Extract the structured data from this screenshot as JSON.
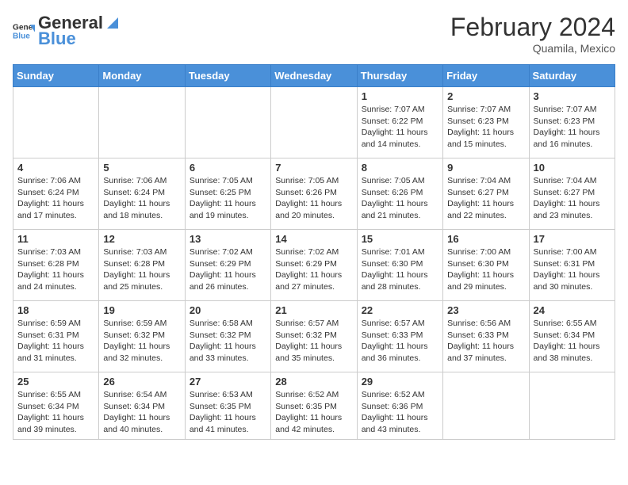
{
  "header": {
    "logo_general": "General",
    "logo_blue": "Blue",
    "month_title": "February 2024",
    "subtitle": "Quamila, Mexico"
  },
  "days_of_week": [
    "Sunday",
    "Monday",
    "Tuesday",
    "Wednesday",
    "Thursday",
    "Friday",
    "Saturday"
  ],
  "weeks": [
    [
      {
        "day": "",
        "info": ""
      },
      {
        "day": "",
        "info": ""
      },
      {
        "day": "",
        "info": ""
      },
      {
        "day": "",
        "info": ""
      },
      {
        "day": "1",
        "info": "Sunrise: 7:07 AM\nSunset: 6:22 PM\nDaylight: 11 hours and 14 minutes."
      },
      {
        "day": "2",
        "info": "Sunrise: 7:07 AM\nSunset: 6:23 PM\nDaylight: 11 hours and 15 minutes."
      },
      {
        "day": "3",
        "info": "Sunrise: 7:07 AM\nSunset: 6:23 PM\nDaylight: 11 hours and 16 minutes."
      }
    ],
    [
      {
        "day": "4",
        "info": "Sunrise: 7:06 AM\nSunset: 6:24 PM\nDaylight: 11 hours and 17 minutes."
      },
      {
        "day": "5",
        "info": "Sunrise: 7:06 AM\nSunset: 6:24 PM\nDaylight: 11 hours and 18 minutes."
      },
      {
        "day": "6",
        "info": "Sunrise: 7:05 AM\nSunset: 6:25 PM\nDaylight: 11 hours and 19 minutes."
      },
      {
        "day": "7",
        "info": "Sunrise: 7:05 AM\nSunset: 6:26 PM\nDaylight: 11 hours and 20 minutes."
      },
      {
        "day": "8",
        "info": "Sunrise: 7:05 AM\nSunset: 6:26 PM\nDaylight: 11 hours and 21 minutes."
      },
      {
        "day": "9",
        "info": "Sunrise: 7:04 AM\nSunset: 6:27 PM\nDaylight: 11 hours and 22 minutes."
      },
      {
        "day": "10",
        "info": "Sunrise: 7:04 AM\nSunset: 6:27 PM\nDaylight: 11 hours and 23 minutes."
      }
    ],
    [
      {
        "day": "11",
        "info": "Sunrise: 7:03 AM\nSunset: 6:28 PM\nDaylight: 11 hours and 24 minutes."
      },
      {
        "day": "12",
        "info": "Sunrise: 7:03 AM\nSunset: 6:28 PM\nDaylight: 11 hours and 25 minutes."
      },
      {
        "day": "13",
        "info": "Sunrise: 7:02 AM\nSunset: 6:29 PM\nDaylight: 11 hours and 26 minutes."
      },
      {
        "day": "14",
        "info": "Sunrise: 7:02 AM\nSunset: 6:29 PM\nDaylight: 11 hours and 27 minutes."
      },
      {
        "day": "15",
        "info": "Sunrise: 7:01 AM\nSunset: 6:30 PM\nDaylight: 11 hours and 28 minutes."
      },
      {
        "day": "16",
        "info": "Sunrise: 7:00 AM\nSunset: 6:30 PM\nDaylight: 11 hours and 29 minutes."
      },
      {
        "day": "17",
        "info": "Sunrise: 7:00 AM\nSunset: 6:31 PM\nDaylight: 11 hours and 30 minutes."
      }
    ],
    [
      {
        "day": "18",
        "info": "Sunrise: 6:59 AM\nSunset: 6:31 PM\nDaylight: 11 hours and 31 minutes."
      },
      {
        "day": "19",
        "info": "Sunrise: 6:59 AM\nSunset: 6:32 PM\nDaylight: 11 hours and 32 minutes."
      },
      {
        "day": "20",
        "info": "Sunrise: 6:58 AM\nSunset: 6:32 PM\nDaylight: 11 hours and 33 minutes."
      },
      {
        "day": "21",
        "info": "Sunrise: 6:57 AM\nSunset: 6:32 PM\nDaylight: 11 hours and 35 minutes."
      },
      {
        "day": "22",
        "info": "Sunrise: 6:57 AM\nSunset: 6:33 PM\nDaylight: 11 hours and 36 minutes."
      },
      {
        "day": "23",
        "info": "Sunrise: 6:56 AM\nSunset: 6:33 PM\nDaylight: 11 hours and 37 minutes."
      },
      {
        "day": "24",
        "info": "Sunrise: 6:55 AM\nSunset: 6:34 PM\nDaylight: 11 hours and 38 minutes."
      }
    ],
    [
      {
        "day": "25",
        "info": "Sunrise: 6:55 AM\nSunset: 6:34 PM\nDaylight: 11 hours and 39 minutes."
      },
      {
        "day": "26",
        "info": "Sunrise: 6:54 AM\nSunset: 6:34 PM\nDaylight: 11 hours and 40 minutes."
      },
      {
        "day": "27",
        "info": "Sunrise: 6:53 AM\nSunset: 6:35 PM\nDaylight: 11 hours and 41 minutes."
      },
      {
        "day": "28",
        "info": "Sunrise: 6:52 AM\nSunset: 6:35 PM\nDaylight: 11 hours and 42 minutes."
      },
      {
        "day": "29",
        "info": "Sunrise: 6:52 AM\nSunset: 6:36 PM\nDaylight: 11 hours and 43 minutes."
      },
      {
        "day": "",
        "info": ""
      },
      {
        "day": "",
        "info": ""
      }
    ]
  ]
}
